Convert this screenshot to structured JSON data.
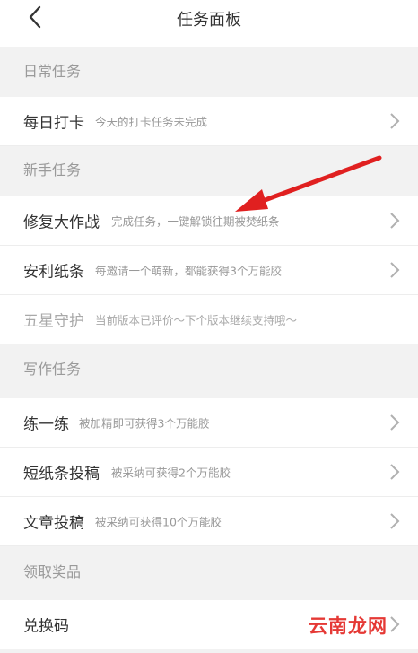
{
  "header": {
    "title": "任务面板",
    "back_icon": "back-arrow-icon"
  },
  "sections": [
    {
      "title": "日常任务",
      "items": [
        {
          "title": "每日打卡",
          "desc": "今天的打卡任务未完成",
          "enabled": true
        }
      ]
    },
    {
      "title": "新手任务",
      "items": [
        {
          "title": "修复大作战",
          "desc": "完成任务，一键解锁往期被焚纸条",
          "enabled": true
        },
        {
          "title": "安利纸条",
          "desc": "每邀请一个萌新，都能获得3个万能胶",
          "enabled": true
        },
        {
          "title": "五星守护",
          "desc": "当前版本已评价～下个版本继续支持哦～",
          "enabled": false
        }
      ]
    },
    {
      "title": "写作任务",
      "items": [
        {
          "title": "练一练",
          "desc": "被加精即可获得3个万能胶",
          "enabled": true
        },
        {
          "title": "短纸条投稿",
          "desc": "被采纳可获得2个万能胶",
          "enabled": true
        },
        {
          "title": "文章投稿",
          "desc": "被采纳可获得10个万能胶",
          "enabled": true
        }
      ]
    },
    {
      "title": "领取奖品",
      "items": [
        {
          "title": "兑换码",
          "desc": "",
          "enabled": true
        }
      ]
    }
  ],
  "watermark": "云南龙网",
  "colors": {
    "annotation_arrow": "#e02020",
    "watermark": "#e53935"
  }
}
